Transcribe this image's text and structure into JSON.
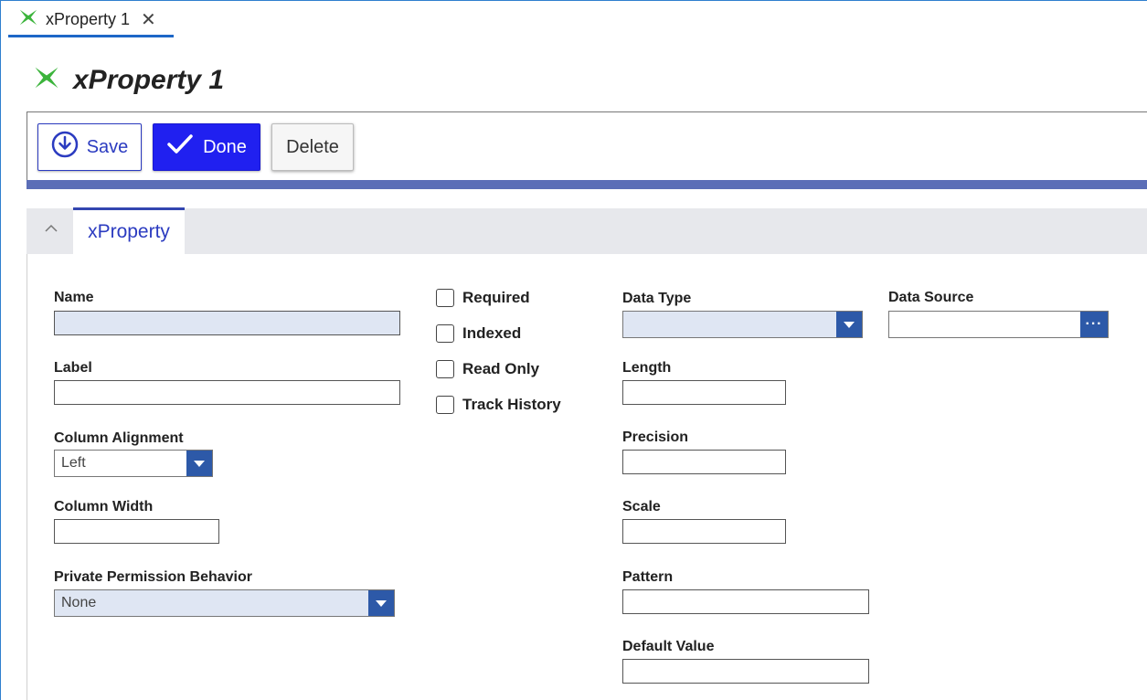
{
  "tab": {
    "label": "xProperty 1",
    "close_glyph": "✕",
    "icon": "xproperty-icon"
  },
  "page": {
    "title": "xProperty 1",
    "icon": "xproperty-icon"
  },
  "toolbar": {
    "save_label": "Save",
    "done_label": "Done",
    "delete_label": "Delete"
  },
  "section": {
    "tab_label": "xProperty",
    "collapse_glyph": "^"
  },
  "form": {
    "name": {
      "label": "Name",
      "value": ""
    },
    "label": {
      "label": "Label",
      "value": ""
    },
    "column_alignment": {
      "label": "Column Alignment",
      "value": "Left"
    },
    "column_width": {
      "label": "Column Width",
      "value": ""
    },
    "private_permission_behavior": {
      "label": "Private Permission Behavior",
      "value": "None"
    },
    "checkboxes": [
      {
        "label": "Required",
        "checked": false
      },
      {
        "label": "Indexed",
        "checked": false
      },
      {
        "label": "Read Only",
        "checked": false
      },
      {
        "label": "Track History",
        "checked": false
      }
    ],
    "data_type": {
      "label": "Data Type",
      "value": ""
    },
    "length": {
      "label": "Length",
      "value": ""
    },
    "precision": {
      "label": "Precision",
      "value": ""
    },
    "scale": {
      "label": "Scale",
      "value": ""
    },
    "pattern": {
      "label": "Pattern",
      "value": ""
    },
    "default_value": {
      "label": "Default Value",
      "value": ""
    },
    "data_source": {
      "label": "Data Source",
      "value": "",
      "button_glyph": "···"
    }
  },
  "colors": {
    "accent": "#2b3bc0",
    "done_bg": "#2020f0",
    "select_arrow": "#2d59a8",
    "icon_green": "#3cb43c",
    "toolbar_bar": "#5b6eb7"
  }
}
